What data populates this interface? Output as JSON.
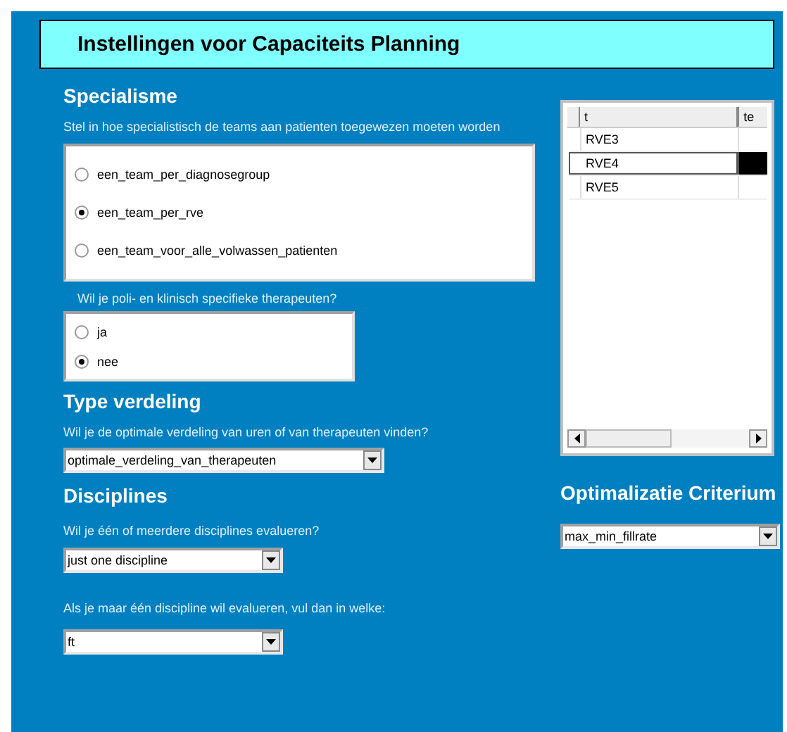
{
  "title": "Instellingen voor Capaciteits Planning",
  "specialisme": {
    "heading": "Specialisme",
    "question": "Stel in hoe specialistisch de teams aan patienten toegewezen moeten worden",
    "options": [
      {
        "label": "een_team_per_diagnosegroup",
        "selected": false
      },
      {
        "label": "een_team_per_rve",
        "selected": true
      },
      {
        "label": "een_team_voor_alle_volwassen_patienten",
        "selected": false
      }
    ],
    "question_2": "Wil je poli- en klinisch specifieke therapeuten?",
    "options_2": [
      {
        "label": "ja",
        "selected": false
      },
      {
        "label": "nee",
        "selected": true
      }
    ]
  },
  "type_verdeling": {
    "heading": "Type verdeling",
    "question": "Wil je de optimale verdeling van uren of van therapeuten vinden?",
    "value": "optimale_verdeling_van_therapeuten"
  },
  "disciplines": {
    "heading": "Disciplines",
    "question": "Wil je één of meerdere disciplines evalueren?",
    "value": "just one discipline",
    "question_2": "Als je maar één discipline wil evalueren, vul dan in welke:",
    "value_2": "ft"
  },
  "grid": {
    "columns": [
      "t",
      "te"
    ],
    "rows": [
      {
        "cells": [
          "RVE3"
        ],
        "selected": false
      },
      {
        "cells": [
          "RVE4"
        ],
        "selected": true
      },
      {
        "cells": [
          "RVE5"
        ],
        "selected": false
      }
    ]
  },
  "criterium": {
    "heading": "Optimalizatie Criterium",
    "value": "max_min_fillrate"
  }
}
